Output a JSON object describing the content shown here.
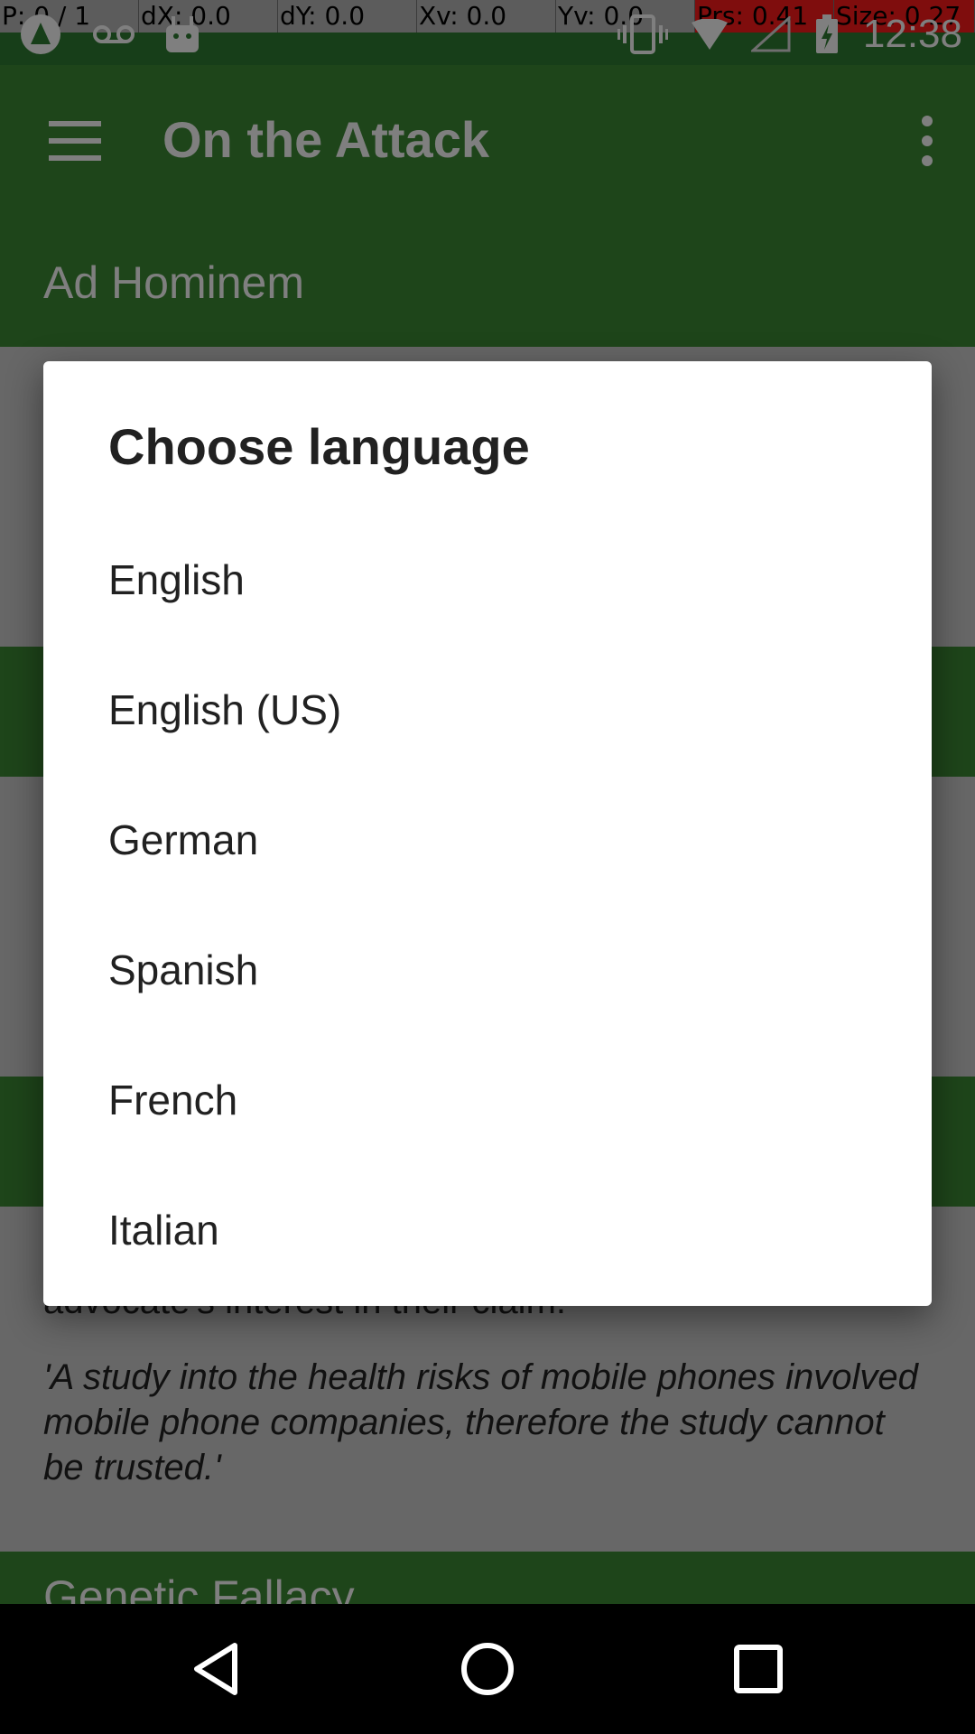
{
  "pointer_bar": {
    "p": "P: 0 / 1",
    "dx": "dX: 0.0",
    "dy": "dY: 0.0",
    "xv": "Xv: 0.0",
    "yv": "Yv: 0.0",
    "prs": "Prs: 0.41",
    "size": "Size: 0.27"
  },
  "status_bar": {
    "time": "12:38",
    "icons": [
      "app-icon",
      "voicemail-icon",
      "android-icon",
      "vibrate-icon",
      "wifi-icon",
      "signal-icon",
      "battery-charging-icon"
    ]
  },
  "toolbar": {
    "title": "On the Attack",
    "icons": [
      "menu-icon",
      "overflow-menu-icon"
    ]
  },
  "background": {
    "section_title": "Ad Hominem",
    "body_tail": "advocate's interest in their claim.",
    "example": "'A study into the health risks of mobile phones involved mobile phone companies, therefore the study cannot be trusted.'",
    "next_section_title": "Genetic Fallacy"
  },
  "dialog": {
    "title": "Choose language",
    "options": [
      "English",
      "English (US)",
      "German",
      "Spanish",
      "French",
      "Italian"
    ]
  },
  "navigation": {
    "icons": [
      "back-icon",
      "home-icon",
      "recents-icon"
    ]
  },
  "colors": {
    "primary": "#3c8a34",
    "status_bar": "#2e7d32",
    "highlight": "#ff1a1a",
    "dialog_bg": "#ffffff",
    "scrim": "rgba(0,0,0,0.5)"
  }
}
